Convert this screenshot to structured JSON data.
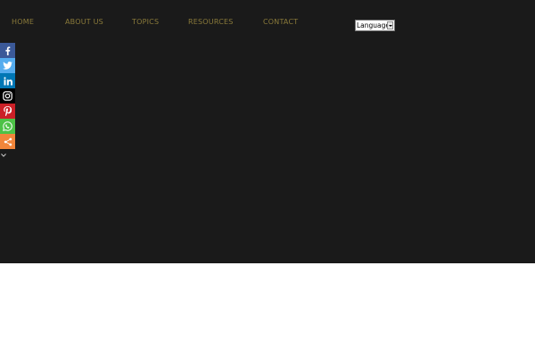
{
  "nav": {
    "items": [
      {
        "label": "HOME"
      },
      {
        "label": "ABOUT US"
      },
      {
        "label": "TOPICS"
      },
      {
        "label": "RESOURCES"
      },
      {
        "label": "CONTACT"
      }
    ]
  },
  "language_select": {
    "selected": "Language"
  },
  "share_bar": {
    "buttons": [
      {
        "icon": "facebook-icon",
        "color": "#3b5998"
      },
      {
        "icon": "twitter-icon",
        "color": "#55acee"
      },
      {
        "icon": "linkedin-icon",
        "color": "#0077b5"
      },
      {
        "icon": "instagram-icon",
        "color": "#000000"
      },
      {
        "icon": "pinterest-icon",
        "color": "#cb2027"
      },
      {
        "icon": "whatsapp-icon",
        "color": "#4dc247"
      },
      {
        "icon": "share-icon",
        "color": "#f2863b"
      }
    ]
  },
  "colors": {
    "hero_background": "#1a1a1a",
    "nav_text": "#8a7a3a",
    "page_background": "#ffffff"
  }
}
